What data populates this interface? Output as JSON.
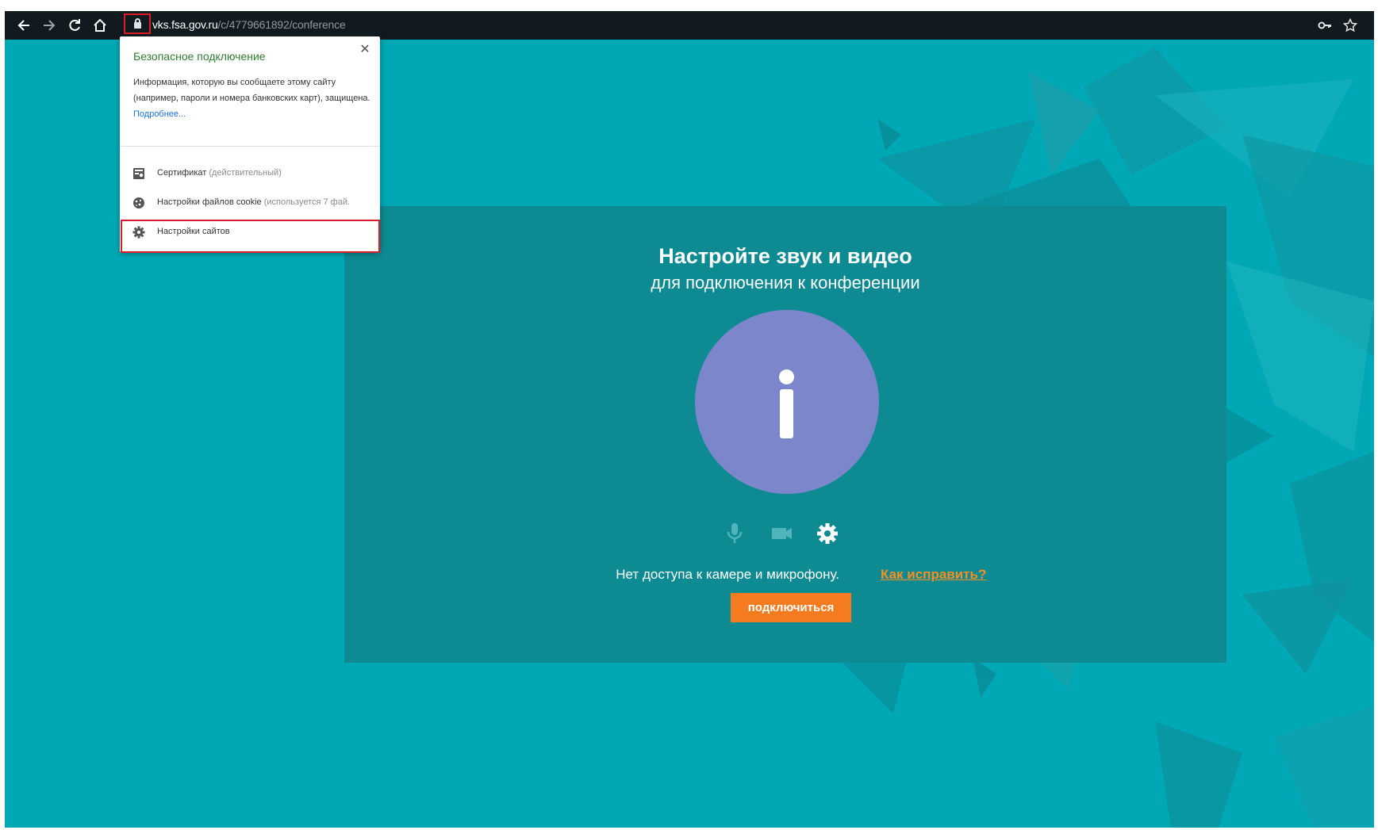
{
  "toolbar": {
    "back_icon": "arrow-left-icon",
    "forward_icon": "arrow-right-icon",
    "reload_icon": "reload-icon",
    "home_icon": "home-icon",
    "url_host": "vks.fsa.gov.ru",
    "url_path": "/c/4779661892/conference",
    "right_icons": [
      "key-icon",
      "star-icon"
    ]
  },
  "popup": {
    "title": "Безопасное подключение",
    "description": "Информация, которую вы сообщаете этому сайту (например, пароли и номера банковских карт), защищена.",
    "more_link": "Подробнее...",
    "items": [
      {
        "icon": "certificate-icon",
        "label": "Сертификат",
        "note": "(действительный)"
      },
      {
        "icon": "cookie-icon",
        "label": "Настройки файлов cookie",
        "note": "(используется 7 фай."
      },
      {
        "icon": "gear-icon",
        "label": "Настройки сайтов",
        "note": ""
      }
    ]
  },
  "main": {
    "title": "Настройте звук и видео",
    "subtitle": "для подключения к конференции",
    "avatar_icon": "info-icon",
    "controls": [
      "microphone-icon",
      "camera-icon",
      "gear-icon"
    ],
    "status_message": "Нет доступа к камере и микрофону.",
    "fix_link": "Как исправить?",
    "join_button": "подключиться"
  },
  "colors": {
    "background": "#00a8b5",
    "panel": "#0e8a93",
    "avatar": "#7b86cb",
    "join_button": "#f47b20",
    "link": "#f7901e",
    "highlight": "#d81e2a",
    "secure_title": "#2f7d34"
  }
}
